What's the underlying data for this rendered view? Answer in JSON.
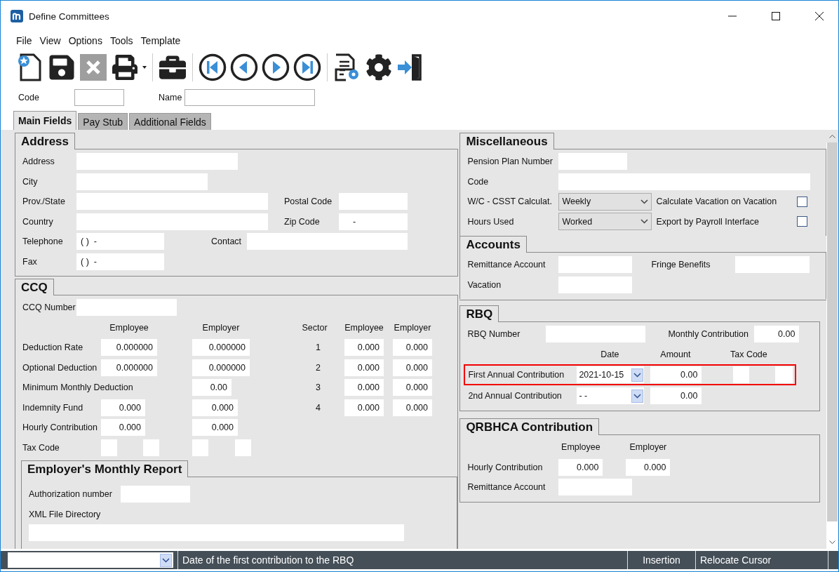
{
  "window": {
    "title": "Define Committees"
  },
  "menu": [
    "File",
    "View",
    "Options",
    "Tools",
    "Template"
  ],
  "header": {
    "code_label": "Code",
    "name_label": "Name"
  },
  "tabs": [
    {
      "label": "Main Fields",
      "selected": true
    },
    {
      "label": "Pay Stub",
      "selected": false
    },
    {
      "label": "Additional Fields",
      "selected": false
    }
  ],
  "address": {
    "title": "Address",
    "address_label": "Address",
    "city_label": "City",
    "prov_label": "Prov./State",
    "postal_label": "Postal Code",
    "country_label": "Country",
    "zip_label": "Zip Code",
    "zip_value": "-",
    "telephone_label": "Telephone",
    "telephone_value": "( )  -",
    "contact_label": "Contact",
    "fax_label": "Fax",
    "fax_value": "( )  -"
  },
  "ccq": {
    "title": "CCQ",
    "number_label": "CCQ Number",
    "headers": [
      "Employee",
      "Employer",
      "Sector",
      "Employee",
      "Employer"
    ],
    "rows": [
      {
        "label": "Deduction Rate",
        "employee": "0.000000",
        "employer": "0.000000",
        "sector": "1",
        "sector_employee": "0.000",
        "sector_employer": "0.000"
      },
      {
        "label": "Optional Deduction",
        "employee": "0.000000",
        "employer": "0.000000",
        "sector": "2",
        "sector_employee": "0.000",
        "sector_employer": "0.000"
      },
      {
        "label": "Minimum Monthly Deduction",
        "employer": "0.00",
        "sector": "3",
        "sector_employee": "0.000",
        "sector_employer": "0.000"
      },
      {
        "label": "Indemnity Fund",
        "employee": "0.000",
        "employer": "0.000",
        "sector": "4",
        "sector_employee": "0.000",
        "sector_employer": "0.000"
      },
      {
        "label": "Hourly Contribution",
        "employee": "0.000",
        "employer": "0.000"
      }
    ],
    "tax_code_label": "Tax Code"
  },
  "monthly_report": {
    "title": "Employer's Monthly Report",
    "authorization_label": "Authorization number",
    "xml_label": "XML File Directory"
  },
  "miscellaneous": {
    "title": "Miscellaneous",
    "pension_label": "Pension Plan Number",
    "code_label": "Code",
    "wc_label": "W/C - CSST Calculat.",
    "wc_value": "Weekly",
    "hours_label": "Hours Used",
    "hours_value": "Worked",
    "options": [
      {
        "label": "Calculate Vacation on Vacation",
        "checked": false
      },
      {
        "label": "Export by Payroll Interface",
        "checked": false
      }
    ]
  },
  "accounts": {
    "title": "Accounts",
    "remittance_label": "Remittance Account",
    "fringe_label": "Fringe Benefits",
    "vacation_label": "Vacation"
  },
  "rbq": {
    "title": "RBQ",
    "number_label": "RBQ Number",
    "monthly_label": "Monthly Contribution",
    "monthly_value": "0.00",
    "headers": [
      "Date",
      "Amount",
      "Tax Code"
    ],
    "contributions": [
      {
        "label": "First Annual Contribution",
        "date": "2021-10-15",
        "amount": "0.00",
        "highlighted": true,
        "tax_code_fields": true
      },
      {
        "label": "2nd Annual Contribution",
        "date": "- -",
        "amount": "0.00",
        "highlighted": false,
        "tax_code_fields": false
      }
    ]
  },
  "qrbhca": {
    "title": "QRBHCA Contribution",
    "headers": [
      "Employee",
      "Employer"
    ],
    "hourly_label": "Hourly Contribution",
    "employee": "0.000",
    "employer": "0.000",
    "remittance_label": "Remittance Account"
  },
  "status_bar": {
    "message": "Date of the first contribution to the RBQ",
    "mode": "Insertion",
    "action": "Relocate Cursor"
  }
}
